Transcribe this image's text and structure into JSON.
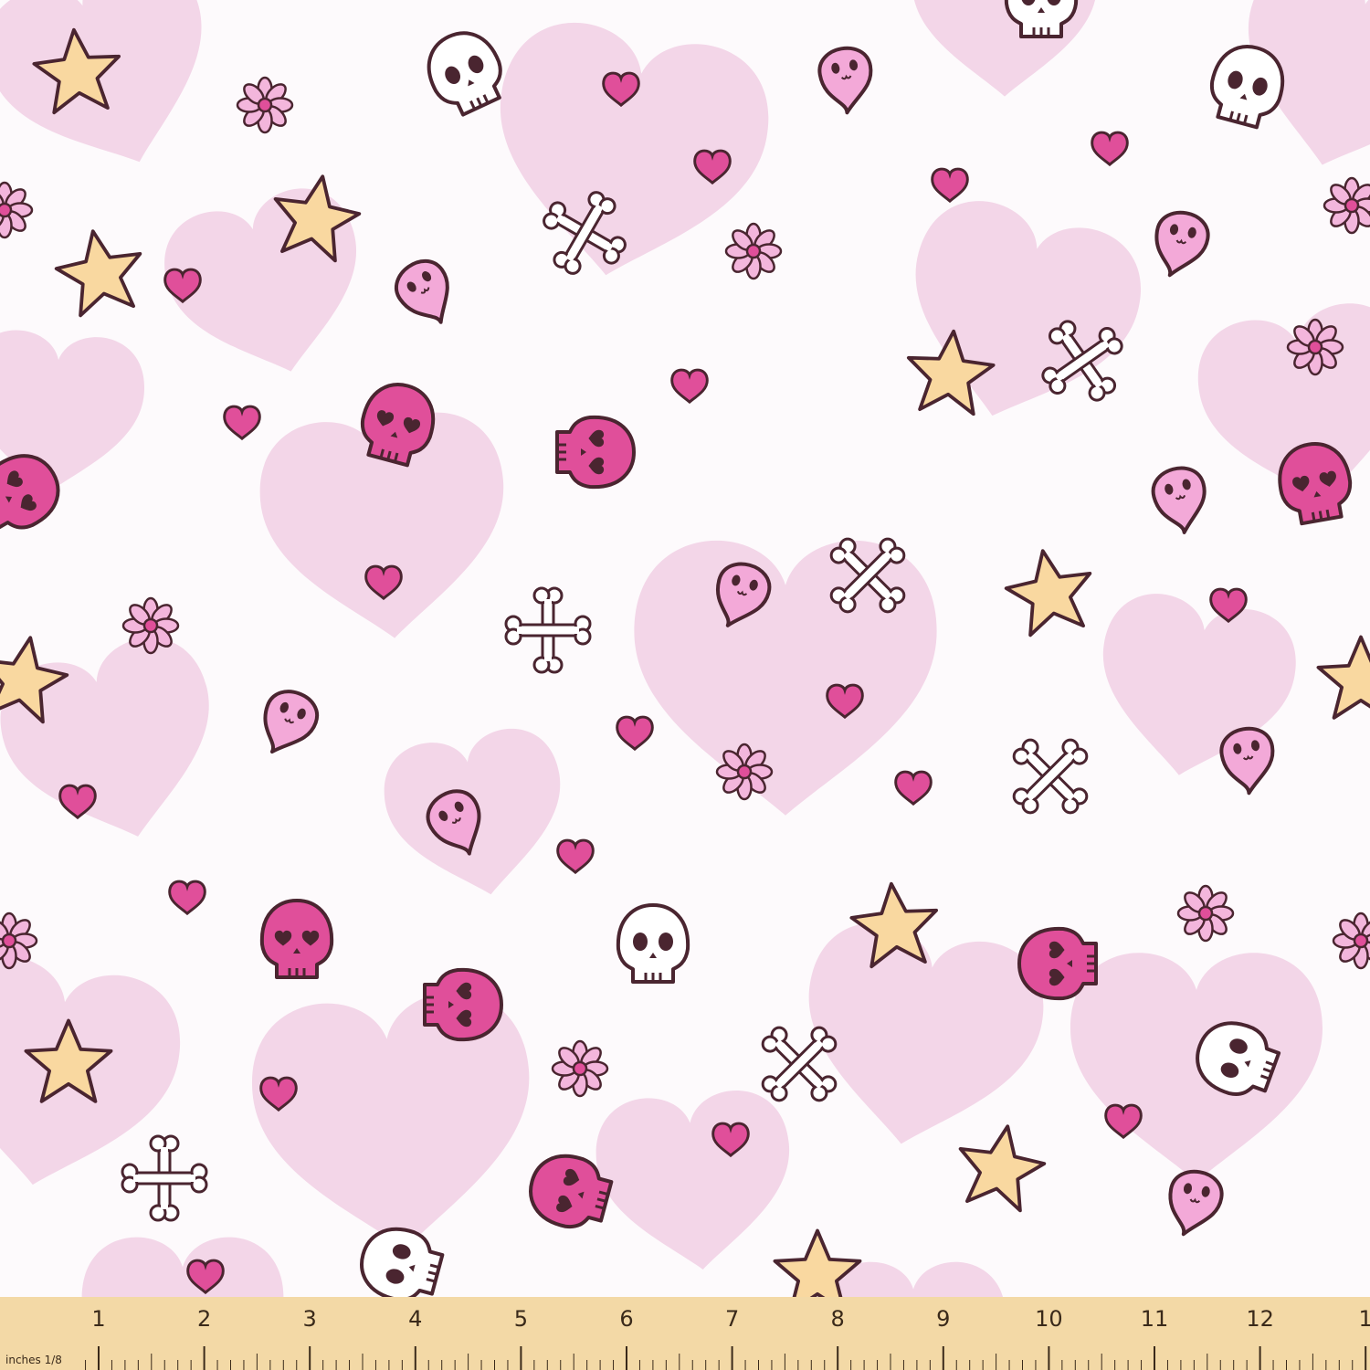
{
  "fabric": {
    "colors": {
      "background": "#fdfafc",
      "big_heart": "#f3d6e8",
      "small_heart": "#e04f9a",
      "outline": "#4a2530",
      "star": "#f9d8a0",
      "skull_pink": "#e04f9a",
      "skull_white": "#ffffff",
      "ghost": "#f3a9d8",
      "flower_petal": "#f3b6dc",
      "flower_center": "#e04f9a",
      "bone": "#ffffff"
    },
    "motifs": [
      "heart-large",
      "heart-small",
      "star",
      "skull-pink",
      "skull-white",
      "ghost",
      "flower",
      "crossbones"
    ]
  },
  "ruler": {
    "unit_label": "inches 1/8",
    "numbers": [
      "1",
      "2",
      "3",
      "4",
      "5",
      "6",
      "7",
      "8",
      "9",
      "10",
      "11",
      "12",
      "1"
    ],
    "color": "#f3d9a6",
    "tick_color": "#3a2a1a"
  }
}
